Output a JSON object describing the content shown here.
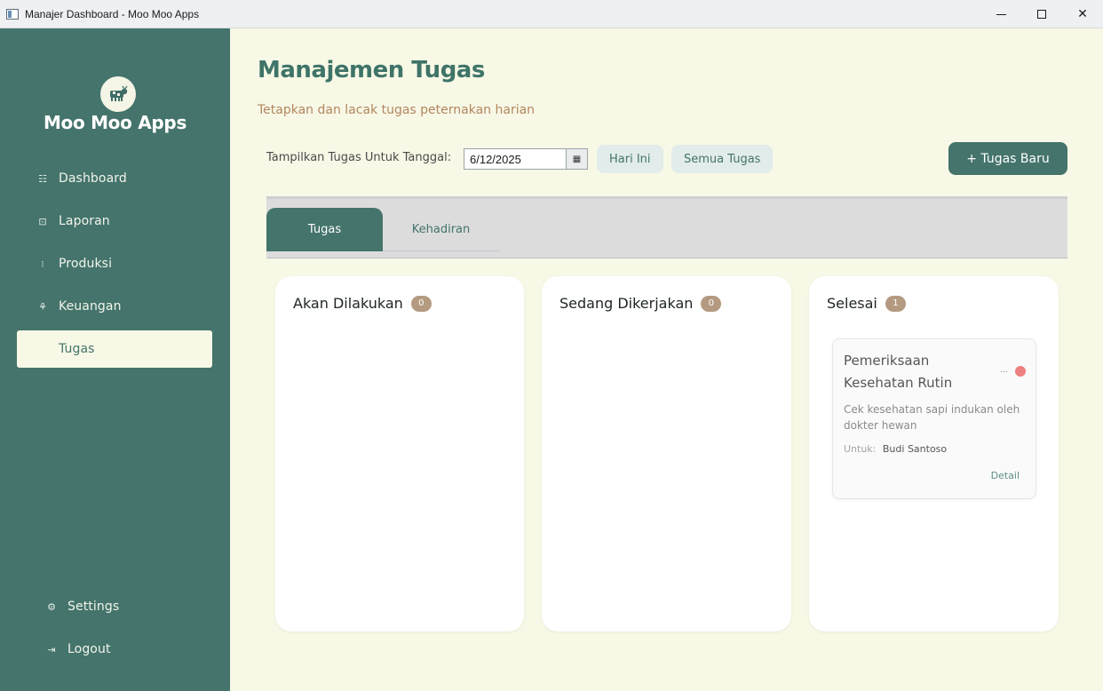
{
  "window": {
    "title": "Manajer Dashboard - Moo Moo Apps",
    "controls": {
      "minimize": "minimize",
      "maximize": "maximize",
      "close": "✕"
    }
  },
  "sidebar": {
    "brand": "Moo Moo Apps",
    "logo_icon": "cow-icon",
    "items": [
      {
        "label": "Dashboard",
        "icon": "dashboard-icon",
        "active": false
      },
      {
        "label": "Laporan",
        "icon": "report-icon",
        "active": false
      },
      {
        "label": "Produksi",
        "icon": "production-icon",
        "active": false
      },
      {
        "label": "Keuangan",
        "icon": "finance-icon",
        "active": false
      },
      {
        "label": "Tugas",
        "icon": "task-icon",
        "active": true
      }
    ],
    "bottom_items": [
      {
        "label": "Settings",
        "icon": "settings-icon"
      },
      {
        "label": "Logout",
        "icon": "logout-icon"
      }
    ]
  },
  "header": {
    "title": "Manajemen Tugas",
    "subtitle": "Tetapkan dan lacak tugas peternakan harian"
  },
  "filter": {
    "label": "Tampilkan Tugas Untuk Tanggal:",
    "date_value": "6/12/2025",
    "today_button": "Hari Ini",
    "all_button": "Semua Tugas",
    "new_task_button": "+ Tugas Baru"
  },
  "tabs": [
    {
      "label": "Tugas",
      "active": true
    },
    {
      "label": "Kehadiran",
      "active": false
    }
  ],
  "columns": [
    {
      "title": "Akan Dilakukan",
      "count": "0",
      "tasks": []
    },
    {
      "title": "Sedang Dikerjakan",
      "count": "0",
      "tasks": []
    },
    {
      "title": "Selesai",
      "count": "1",
      "tasks": [
        {
          "title": "Pemeriksaan Kesehatan Rutin",
          "more": "...",
          "description": "Cek kesehatan sapi indukan oleh dokter hewan",
          "assign_label": "Untuk:",
          "assignee": "Budi Santoso",
          "detail_link": "Detail",
          "priority_color": "#ed8080"
        }
      ]
    }
  ],
  "colors": {
    "sidebar": "#44746c",
    "background": "#f7f8e6",
    "accent": "#3f7468",
    "subtitle": "#b48660",
    "badge": "#b39a80"
  }
}
